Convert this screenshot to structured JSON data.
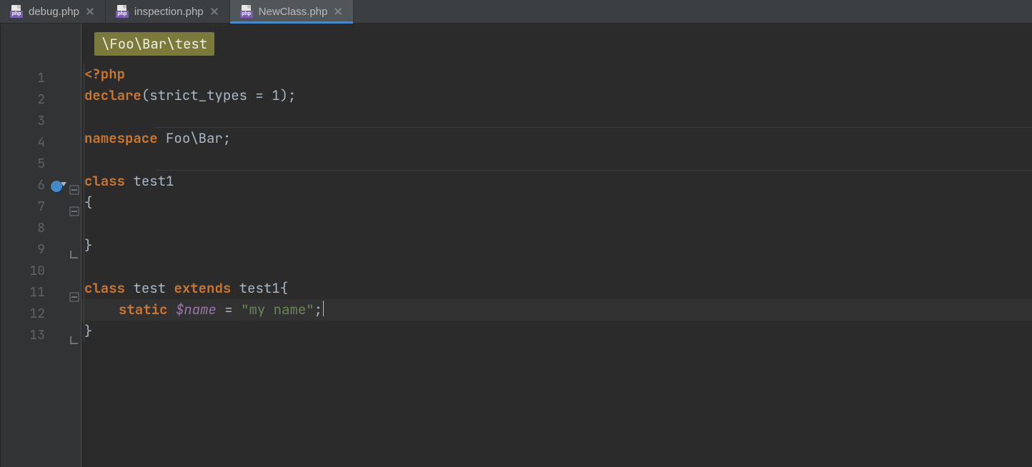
{
  "tabs": [
    {
      "label": "debug.php",
      "active": false
    },
    {
      "label": "inspection.php",
      "active": false
    },
    {
      "label": "NewClass.php",
      "active": true
    }
  ],
  "breadcrumb": "\\Foo\\Bar\\test",
  "gutter": {
    "start": 1,
    "end": 13,
    "override_line": 6
  },
  "code": {
    "l1": {
      "open": "<?php"
    },
    "l2": {
      "kw": "declare",
      "paren_open": "(",
      "arg": "strict_types = 1",
      "paren_close": ")",
      "semi": ";"
    },
    "l4": {
      "kw": "namespace",
      "sp": " ",
      "ns": "Foo\\Bar",
      "semi": ";"
    },
    "l6": {
      "kw": "class",
      "sp": " ",
      "name": "test1"
    },
    "l7": {
      "brace": "{"
    },
    "l9": {
      "brace": "}"
    },
    "l11": {
      "kw1": "class",
      "sp1": " ",
      "name": "test",
      "sp2": " ",
      "kw2": "extends",
      "sp3": " ",
      "base": "test1",
      "brace": "{"
    },
    "l12": {
      "kw": "static",
      "sp": " ",
      "var": "$name",
      "sp2": " ",
      "eq": "=",
      "sp3": " ",
      "str": "\"my name\"",
      "semi": ";"
    },
    "l13": {
      "brace": "}"
    }
  },
  "icon_badge": "php"
}
